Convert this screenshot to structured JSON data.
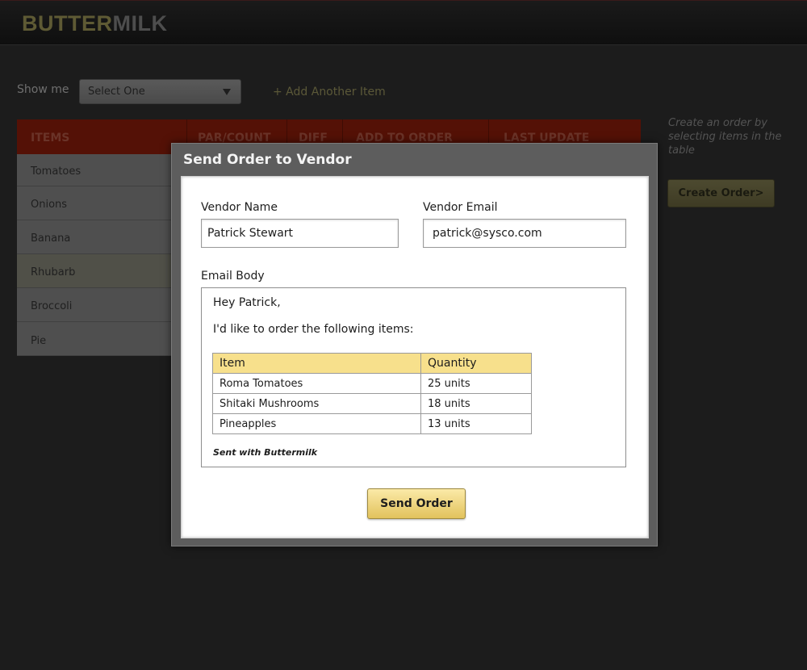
{
  "app": {
    "logo_part1": "BUTTER",
    "logo_part2": "MILK"
  },
  "filters": {
    "show_me_label": "Show me",
    "select_value": "Select One",
    "add_item_link": "+ Add Another Item"
  },
  "table": {
    "columns": [
      "ITEMS",
      "PAR/COUNT",
      "DIFF",
      "ADD TO ORDER",
      "LAST UPDATE"
    ],
    "rows": [
      "Tomatoes",
      "Onions",
      "Banana",
      "Rhubarb",
      "Broccoli",
      "Pie"
    ]
  },
  "sidebar": {
    "hint": "Create an order by selecting items in the table",
    "create_button": "Create Order>"
  },
  "modal": {
    "title": "Send Order to Vendor",
    "vendor_name_label": "Vendor Name",
    "vendor_name_value": "Patrick Stewart",
    "vendor_email_label": "Vendor Email",
    "vendor_email_value": "patrick@sysco.com",
    "email_body_label": "Email Body",
    "email": {
      "greeting": "Hey Patrick,",
      "intro": "I'd like to order the following items:",
      "table_headers": [
        "Item",
        "Quantity"
      ],
      "items": [
        {
          "name": "Roma Tomatoes",
          "qty": "25 units"
        },
        {
          "name": "Shitaki Mushrooms",
          "qty": "18 units"
        },
        {
          "name": "Pineapples",
          "qty": "13 units"
        }
      ],
      "signoff": "Sent with Buttermilk"
    },
    "send_button": "Send Order"
  },
  "colors": {
    "accent_gold": "#f7e08c",
    "table_header_red": "#541106",
    "background": "#1c1c1c"
  }
}
